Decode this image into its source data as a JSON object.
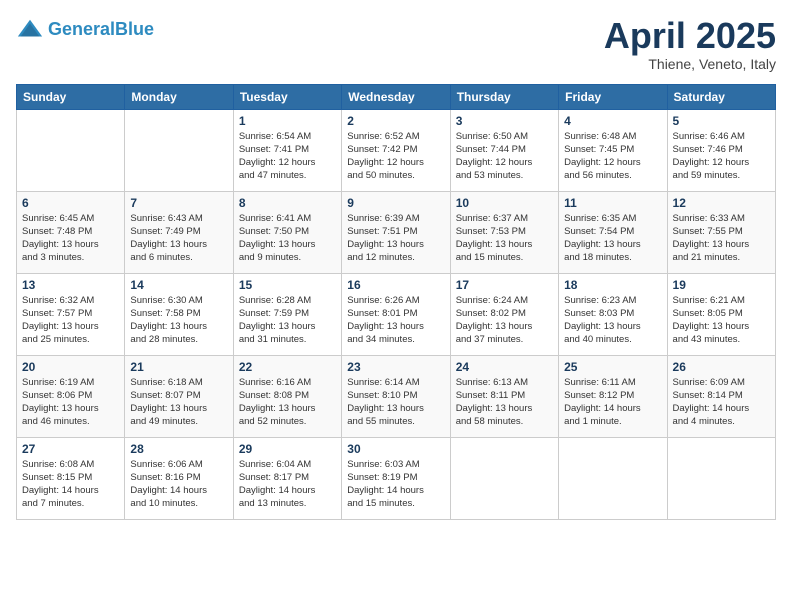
{
  "header": {
    "logo_line1": "General",
    "logo_line2": "Blue",
    "month_title": "April 2025",
    "location": "Thiene, Veneto, Italy"
  },
  "weekdays": [
    "Sunday",
    "Monday",
    "Tuesday",
    "Wednesday",
    "Thursday",
    "Friday",
    "Saturday"
  ],
  "weeks": [
    [
      {
        "day": "",
        "info": ""
      },
      {
        "day": "",
        "info": ""
      },
      {
        "day": "1",
        "info": "Sunrise: 6:54 AM\nSunset: 7:41 PM\nDaylight: 12 hours\nand 47 minutes."
      },
      {
        "day": "2",
        "info": "Sunrise: 6:52 AM\nSunset: 7:42 PM\nDaylight: 12 hours\nand 50 minutes."
      },
      {
        "day": "3",
        "info": "Sunrise: 6:50 AM\nSunset: 7:44 PM\nDaylight: 12 hours\nand 53 minutes."
      },
      {
        "day": "4",
        "info": "Sunrise: 6:48 AM\nSunset: 7:45 PM\nDaylight: 12 hours\nand 56 minutes."
      },
      {
        "day": "5",
        "info": "Sunrise: 6:46 AM\nSunset: 7:46 PM\nDaylight: 12 hours\nand 59 minutes."
      }
    ],
    [
      {
        "day": "6",
        "info": "Sunrise: 6:45 AM\nSunset: 7:48 PM\nDaylight: 13 hours\nand 3 minutes."
      },
      {
        "day": "7",
        "info": "Sunrise: 6:43 AM\nSunset: 7:49 PM\nDaylight: 13 hours\nand 6 minutes."
      },
      {
        "day": "8",
        "info": "Sunrise: 6:41 AM\nSunset: 7:50 PM\nDaylight: 13 hours\nand 9 minutes."
      },
      {
        "day": "9",
        "info": "Sunrise: 6:39 AM\nSunset: 7:51 PM\nDaylight: 13 hours\nand 12 minutes."
      },
      {
        "day": "10",
        "info": "Sunrise: 6:37 AM\nSunset: 7:53 PM\nDaylight: 13 hours\nand 15 minutes."
      },
      {
        "day": "11",
        "info": "Sunrise: 6:35 AM\nSunset: 7:54 PM\nDaylight: 13 hours\nand 18 minutes."
      },
      {
        "day": "12",
        "info": "Sunrise: 6:33 AM\nSunset: 7:55 PM\nDaylight: 13 hours\nand 21 minutes."
      }
    ],
    [
      {
        "day": "13",
        "info": "Sunrise: 6:32 AM\nSunset: 7:57 PM\nDaylight: 13 hours\nand 25 minutes."
      },
      {
        "day": "14",
        "info": "Sunrise: 6:30 AM\nSunset: 7:58 PM\nDaylight: 13 hours\nand 28 minutes."
      },
      {
        "day": "15",
        "info": "Sunrise: 6:28 AM\nSunset: 7:59 PM\nDaylight: 13 hours\nand 31 minutes."
      },
      {
        "day": "16",
        "info": "Sunrise: 6:26 AM\nSunset: 8:01 PM\nDaylight: 13 hours\nand 34 minutes."
      },
      {
        "day": "17",
        "info": "Sunrise: 6:24 AM\nSunset: 8:02 PM\nDaylight: 13 hours\nand 37 minutes."
      },
      {
        "day": "18",
        "info": "Sunrise: 6:23 AM\nSunset: 8:03 PM\nDaylight: 13 hours\nand 40 minutes."
      },
      {
        "day": "19",
        "info": "Sunrise: 6:21 AM\nSunset: 8:05 PM\nDaylight: 13 hours\nand 43 minutes."
      }
    ],
    [
      {
        "day": "20",
        "info": "Sunrise: 6:19 AM\nSunset: 8:06 PM\nDaylight: 13 hours\nand 46 minutes."
      },
      {
        "day": "21",
        "info": "Sunrise: 6:18 AM\nSunset: 8:07 PM\nDaylight: 13 hours\nand 49 minutes."
      },
      {
        "day": "22",
        "info": "Sunrise: 6:16 AM\nSunset: 8:08 PM\nDaylight: 13 hours\nand 52 minutes."
      },
      {
        "day": "23",
        "info": "Sunrise: 6:14 AM\nSunset: 8:10 PM\nDaylight: 13 hours\nand 55 minutes."
      },
      {
        "day": "24",
        "info": "Sunrise: 6:13 AM\nSunset: 8:11 PM\nDaylight: 13 hours\nand 58 minutes."
      },
      {
        "day": "25",
        "info": "Sunrise: 6:11 AM\nSunset: 8:12 PM\nDaylight: 14 hours\nand 1 minute."
      },
      {
        "day": "26",
        "info": "Sunrise: 6:09 AM\nSunset: 8:14 PM\nDaylight: 14 hours\nand 4 minutes."
      }
    ],
    [
      {
        "day": "27",
        "info": "Sunrise: 6:08 AM\nSunset: 8:15 PM\nDaylight: 14 hours\nand 7 minutes."
      },
      {
        "day": "28",
        "info": "Sunrise: 6:06 AM\nSunset: 8:16 PM\nDaylight: 14 hours\nand 10 minutes."
      },
      {
        "day": "29",
        "info": "Sunrise: 6:04 AM\nSunset: 8:17 PM\nDaylight: 14 hours\nand 13 minutes."
      },
      {
        "day": "30",
        "info": "Sunrise: 6:03 AM\nSunset: 8:19 PM\nDaylight: 14 hours\nand 15 minutes."
      },
      {
        "day": "",
        "info": ""
      },
      {
        "day": "",
        "info": ""
      },
      {
        "day": "",
        "info": ""
      }
    ]
  ]
}
